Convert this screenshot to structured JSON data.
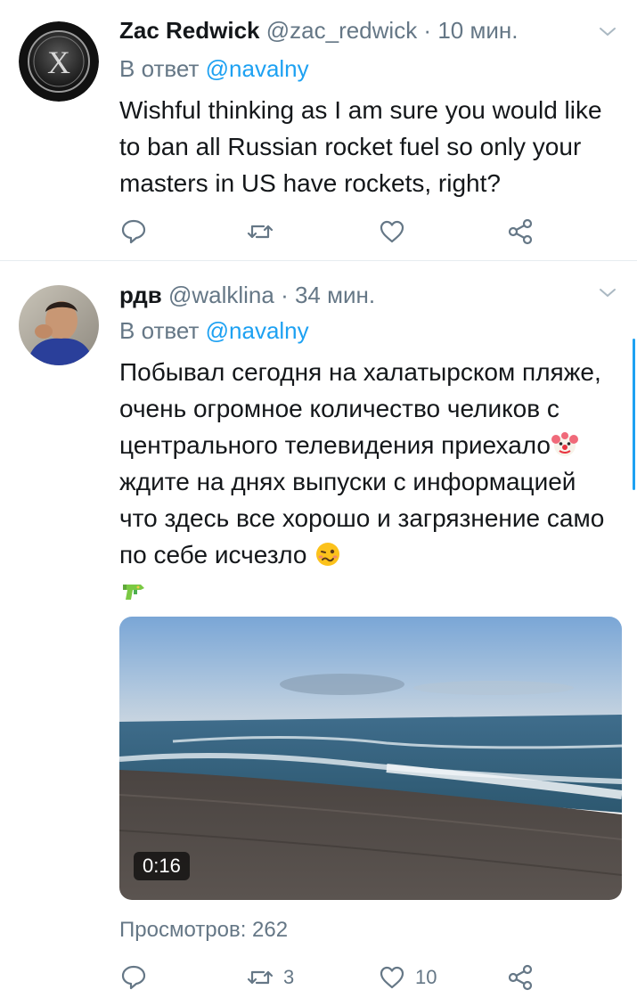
{
  "colors": {
    "accent": "#1da1f2",
    "secondary_text": "#657786",
    "primary_text": "#14171a",
    "divider": "#e6ecf0"
  },
  "tweets": [
    {
      "display_name": "Zac Redwick",
      "handle": "@zac_redwick",
      "separator": " · ",
      "time": "10 мин.",
      "reply_prefix": "В ответ ",
      "reply_handle": "@navalny",
      "text": "Wishful thinking as I am sure you would like to ban all Russian rocket fuel so only your masters in US have rockets, right?",
      "avatar_icon": "x-logo-avatar",
      "actions": [
        {
          "icon": "reply-icon",
          "count": ""
        },
        {
          "icon": "retweet-icon",
          "count": ""
        },
        {
          "icon": "like-icon",
          "count": ""
        },
        {
          "icon": "share-icon",
          "count": ""
        }
      ]
    },
    {
      "display_name": "рдв",
      "handle": "@walklina",
      "separator": " · ",
      "time": "34 мин.",
      "reply_prefix": "В ответ ",
      "reply_handle": "@navalny",
      "text_part1": "Побывал сегодня на халатырском пляже, очень огромное количество челиков с центрального телевидения приехало",
      "text_part2": " ждите на днях выпуски с информацией что здесь все хорошо и загрязнение само по себе исчезло ",
      "emojis": [
        "clown-face-emoji",
        "woozy-face-emoji",
        "water-pistol-emoji"
      ],
      "avatar_icon": "user-photo-avatar",
      "video_duration": "0:16",
      "views": "Просмотров: 262",
      "actions": [
        {
          "icon": "reply-icon",
          "count": ""
        },
        {
          "icon": "retweet-icon",
          "count": "3"
        },
        {
          "icon": "like-icon",
          "count": "10"
        },
        {
          "icon": "share-icon",
          "count": ""
        }
      ]
    }
  ]
}
